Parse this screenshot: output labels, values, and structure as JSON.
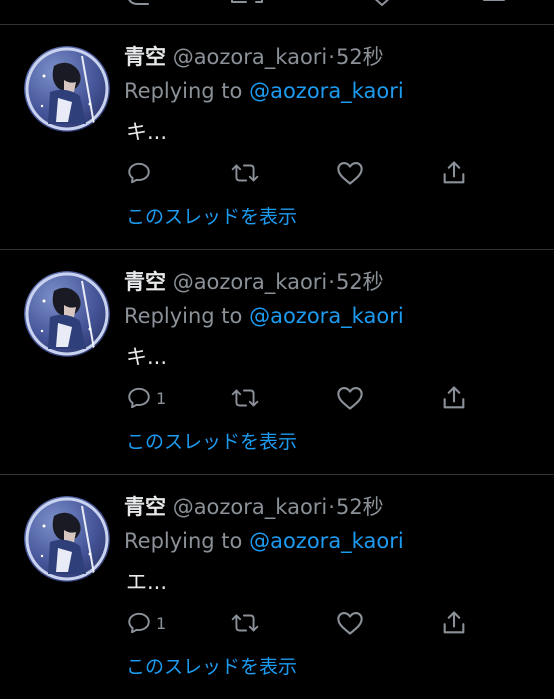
{
  "theme": {
    "background": "#000000",
    "primary_text": "#e7e9ea",
    "secondary_text": "#8b9198",
    "accent": "#1d9bf0",
    "divider": "#2f3336"
  },
  "tweets": [
    {
      "name": "青空",
      "handle": "@aozora_kaori",
      "separator": "·",
      "time": "52秒",
      "replying_prefix": "Replying to",
      "replying_to": "@aozora_kaori",
      "text": "キ...",
      "reply_count": "",
      "show_thread": "このスレッドを表示"
    },
    {
      "name": "青空",
      "handle": "@aozora_kaori",
      "separator": "·",
      "time": "52秒",
      "replying_prefix": "Replying to",
      "replying_to": "@aozora_kaori",
      "text": "キ...",
      "reply_count": "1",
      "show_thread": "このスレッドを表示"
    },
    {
      "name": "青空",
      "handle": "@aozora_kaori",
      "separator": "·",
      "time": "52秒",
      "replying_prefix": "Replying to",
      "replying_to": "@aozora_kaori",
      "text": "エ...",
      "reply_count": "1",
      "show_thread": "このスレッドを表示"
    }
  ],
  "icons": [
    "reply-icon",
    "retweet-icon",
    "like-icon",
    "share-icon"
  ]
}
